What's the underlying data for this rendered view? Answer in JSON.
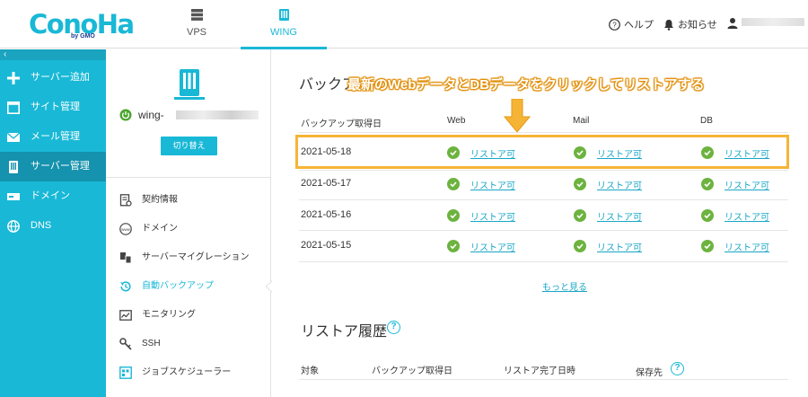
{
  "brand": {
    "logo": "ConoHa",
    "logo_sub": "by GMO"
  },
  "topnav": {
    "tabs": [
      {
        "label": "VPS",
        "icon": "server-stack-icon"
      },
      {
        "label": "WING",
        "icon": "wing-server-icon"
      }
    ],
    "help_label": "ヘルプ",
    "notice_label": "お知らせ"
  },
  "sidebar": {
    "collapse_glyph": "‹",
    "items": [
      {
        "label": "サーバー追加",
        "icon": "plus-icon"
      },
      {
        "label": "サイト管理",
        "icon": "window-icon"
      },
      {
        "label": "メール管理",
        "icon": "mail-icon"
      },
      {
        "label": "サーバー管理",
        "icon": "server-icon"
      },
      {
        "label": "ドメイン",
        "icon": "domain-icon"
      },
      {
        "label": "DNS",
        "icon": "globe-icon"
      }
    ]
  },
  "subpanel": {
    "server_name_prefix": "wing-",
    "switch_label": "切り替え",
    "items": [
      {
        "label": "契約情報",
        "icon": "contract-icon"
      },
      {
        "label": "ドメイン",
        "icon": "www-icon"
      },
      {
        "label": "サーバーマイグレーション",
        "icon": "migration-icon"
      },
      {
        "label": "自動バックアップ",
        "icon": "backup-icon"
      },
      {
        "label": "モニタリング",
        "icon": "monitor-icon"
      },
      {
        "label": "SSH",
        "icon": "key-icon"
      },
      {
        "label": "ジョブスケジューラー",
        "icon": "scheduler-icon"
      }
    ]
  },
  "backup": {
    "title": "バックア",
    "annotation": "最新のWebデータとDBデータをクリックしてリストアする",
    "columns": [
      "バックアップ取得日",
      "Web",
      "Mail",
      "DB"
    ],
    "link_label": "リストア可",
    "rows": [
      {
        "date": "2021-05-18"
      },
      {
        "date": "2021-05-17"
      },
      {
        "date": "2021-05-16"
      },
      {
        "date": "2021-05-15"
      }
    ],
    "more_label": "もっと見る"
  },
  "restore_history": {
    "title": "リストア履歴",
    "help_glyph": "?",
    "columns": [
      "対象",
      "バックアップ取得日",
      "リストア完了日時",
      "保存先"
    ]
  },
  "colors": {
    "accent": "#19b8d6",
    "sidebar_active": "#1592ad",
    "ok": "#6db33f",
    "highlight": "#f6b437"
  }
}
